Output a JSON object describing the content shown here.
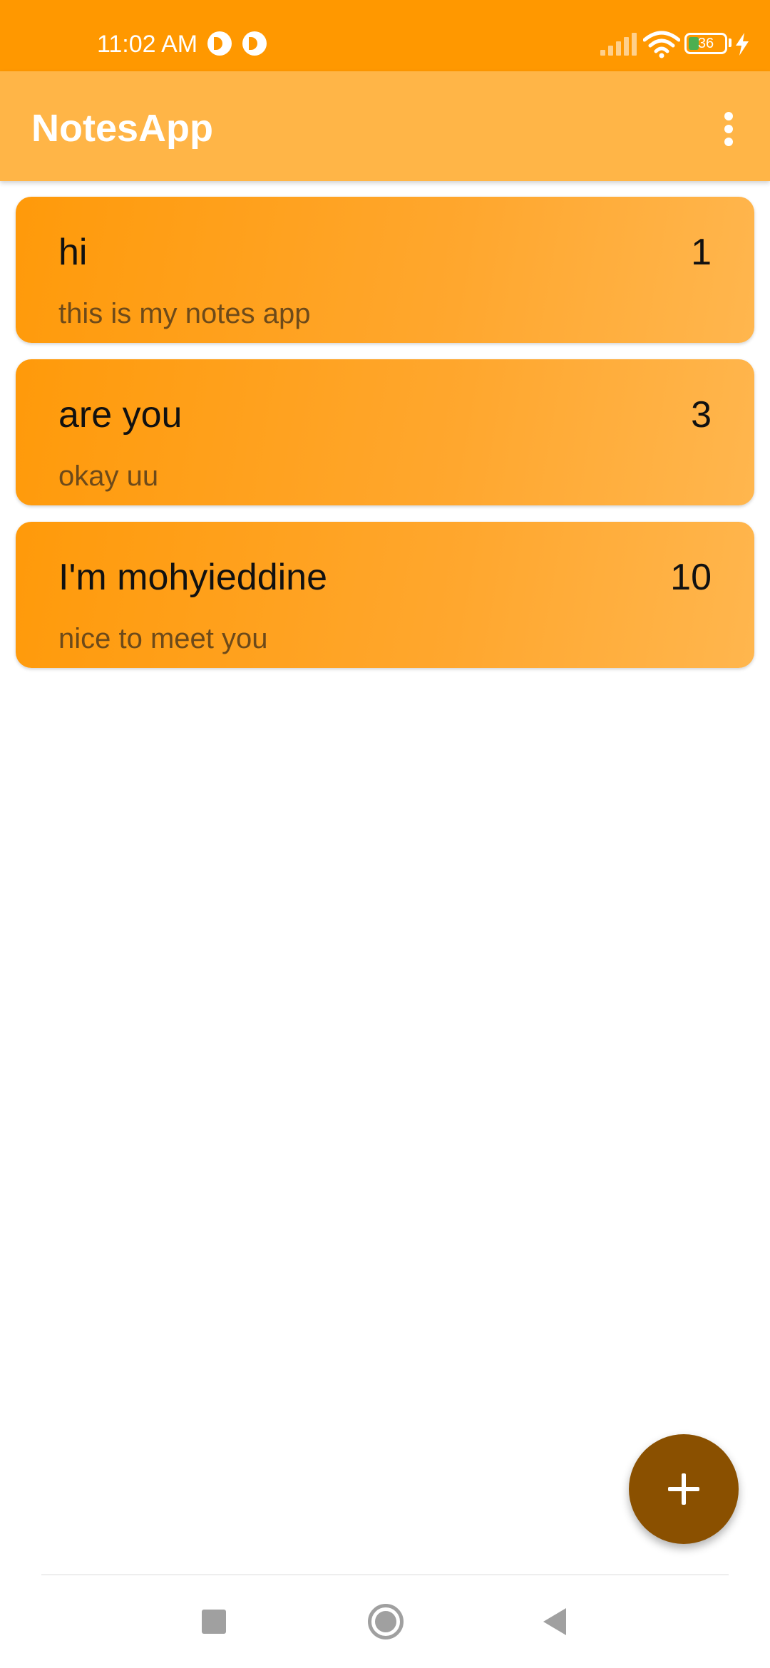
{
  "status_bar": {
    "time": "11:02 AM",
    "notification_icons": [
      "app-notification-icon",
      "app-notification-icon"
    ],
    "battery_level": "36",
    "charging": true,
    "icons": [
      "signal-icon",
      "wifi-icon",
      "battery-icon",
      "charging-bolt-icon"
    ]
  },
  "app_bar": {
    "title": "NotesApp",
    "overflow_icon": "more-vertical-icon"
  },
  "notes": [
    {
      "title": "hi",
      "number": "1",
      "description": "this is my notes app"
    },
    {
      "title": "are you",
      "number": "3",
      "description": "okay uu"
    },
    {
      "title": "I'm mohyieddine",
      "number": "10",
      "description": "nice to meet you"
    }
  ],
  "fab": {
    "icon": "plus-icon"
  },
  "nav_bar": {
    "icons": [
      "recents-icon",
      "home-icon",
      "back-icon"
    ]
  },
  "colors": {
    "status_bar": "#ff9800",
    "app_bar": "#ffb547",
    "card_start": "#ff9a0a",
    "card_end": "#ffb64e",
    "fab": "#8a5000",
    "description_text": "#6d4a1a"
  }
}
